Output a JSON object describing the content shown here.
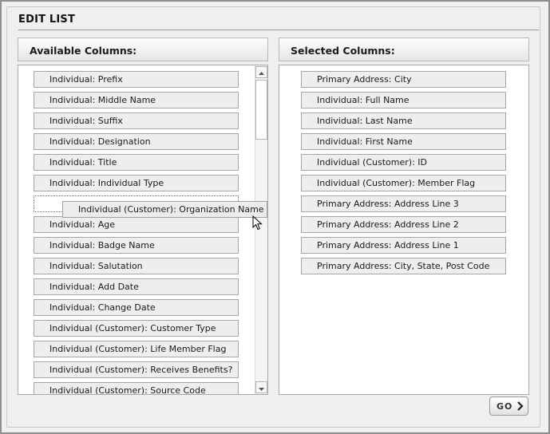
{
  "header": {
    "title": "EDIT LIST"
  },
  "available": {
    "heading": "Available Columns:",
    "items": [
      "Individual: Prefix",
      "Individual: Middle Name",
      "Individual: Suffix",
      "Individual: Designation",
      "Individual: Title",
      "Individual: Individual Type",
      "",
      "Individual: Age",
      "Individual: Badge Name",
      "Individual: Salutation",
      "Individual: Add Date",
      "Individual: Change Date",
      "Individual (Customer): Customer Type",
      "Individual (Customer): Life Member Flag",
      "Individual (Customer): Receives Benefits?",
      "Individual (Customer): Source Code"
    ]
  },
  "dragging": {
    "label": "Individual (Customer): Organization Name"
  },
  "selected": {
    "heading": "Selected Columns:",
    "items": [
      "Primary Address: City",
      "Individual: Full Name",
      "Individual: Last Name",
      "Individual: First Name",
      "Individual (Customer): ID",
      "Individual (Customer): Member Flag",
      "Primary Address: Address Line 3",
      "Primary Address: Address Line 2",
      "Primary Address: Address Line 1",
      "Primary Address: City, State, Post Code"
    ]
  },
  "actions": {
    "go_label": "GO"
  },
  "icons": {
    "scroll_up": "triangle-up-icon",
    "scroll_down": "triangle-down-icon",
    "go_arrow": "chevron-right-icon",
    "cursor": "mouse-pointer-icon"
  }
}
